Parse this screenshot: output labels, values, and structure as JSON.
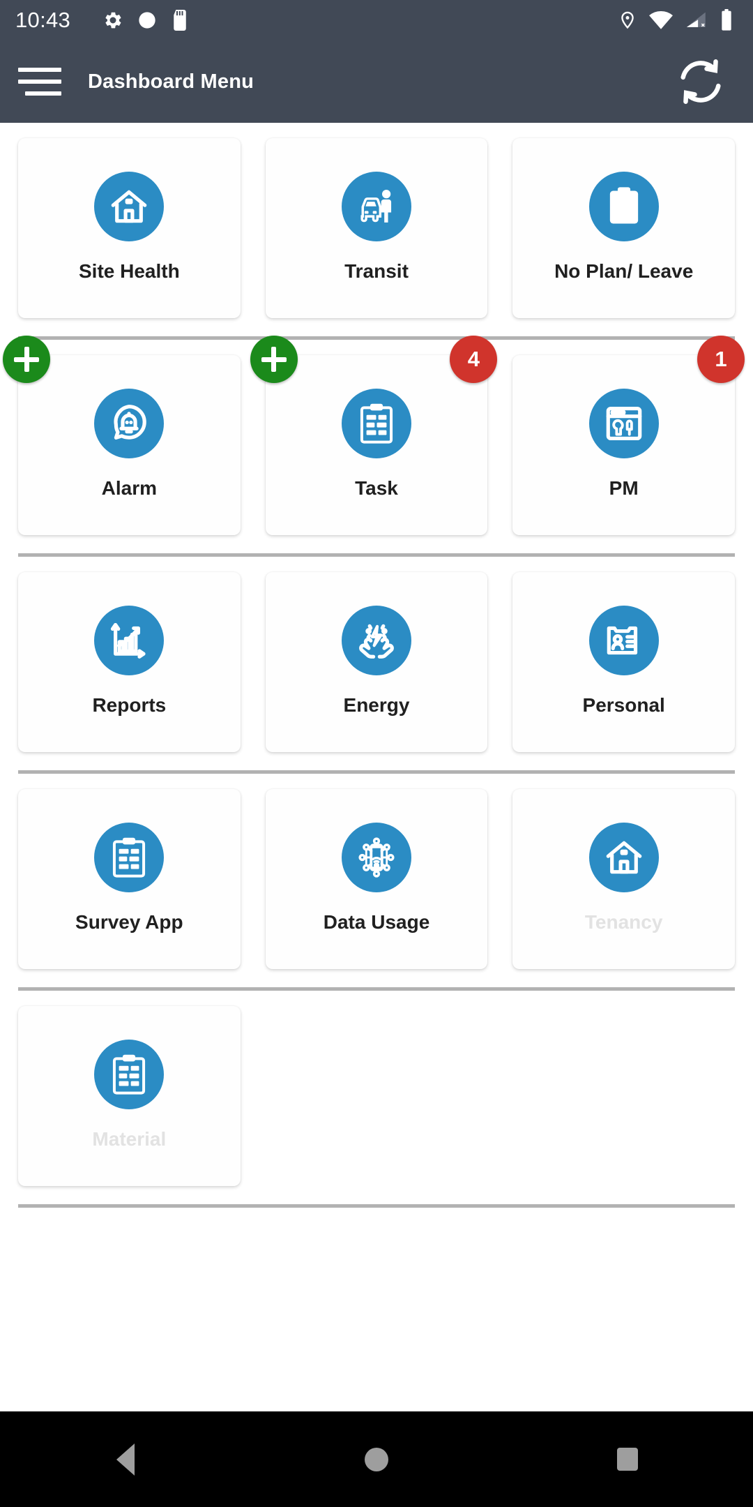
{
  "status_bar": {
    "time": "10:43",
    "left_icons": [
      "gear-icon",
      "circle-icon",
      "sd-card-icon"
    ],
    "right_icons": [
      "location-pin-icon",
      "wifi-icon",
      "cellular-no-signal-icon",
      "battery-icon"
    ],
    "background_color": "#414956"
  },
  "app_bar": {
    "menu_icon": "hamburger-menu-icon",
    "title": "Dashboard Menu",
    "action_icon": "sync-refresh-icon",
    "background_color": "#414956"
  },
  "theme": {
    "icon_circle_color": "#2b8cc4",
    "badge_color": "#d0342c",
    "add_button_color": "#1b8a1b",
    "divider_color": "#b2b2b2",
    "disabled_label_color": "#e2e2e2"
  },
  "rows": [
    {
      "cells": [
        {
          "label": "Site Health",
          "icon": "house-icon",
          "enabled": true,
          "badge": null,
          "add_button": false
        },
        {
          "label": "Transit",
          "icon": "car-person-icon",
          "enabled": true,
          "badge": null,
          "add_button": false
        },
        {
          "label": "No Plan/ Leave",
          "icon": "clipboard-blank-icon",
          "enabled": true,
          "badge": null,
          "add_button": false
        }
      ]
    },
    {
      "cells": [
        {
          "label": "Alarm",
          "icon": "bell-alert-icon",
          "enabled": true,
          "badge": null,
          "add_button": true
        },
        {
          "label": "Task",
          "icon": "clipboard-list-icon",
          "enabled": true,
          "badge": "4",
          "add_button": true
        },
        {
          "label": "PM",
          "icon": "maintenance-tools-icon",
          "enabled": true,
          "badge": "1",
          "add_button": false
        }
      ]
    },
    {
      "cells": [
        {
          "label": "Reports",
          "icon": "bar-chart-growth-icon",
          "enabled": true,
          "badge": null,
          "add_button": false
        },
        {
          "label": "Energy",
          "icon": "hands-lightning-icon",
          "enabled": true,
          "badge": null,
          "add_button": false
        },
        {
          "label": "Personal",
          "icon": "id-card-icon",
          "enabled": true,
          "badge": null,
          "add_button": false
        }
      ]
    },
    {
      "cells": [
        {
          "label": "Survey App",
          "icon": "clipboard-survey-icon",
          "enabled": true,
          "badge": null,
          "add_button": false
        },
        {
          "label": "Data Usage",
          "icon": "phone-network-icon",
          "enabled": true,
          "badge": null,
          "add_button": false
        },
        {
          "label": "Tenancy",
          "icon": "house-icon",
          "enabled": false,
          "badge": null,
          "add_button": false
        }
      ]
    },
    {
      "cells": [
        {
          "label": "Material",
          "icon": "clipboard-survey-icon",
          "enabled": false,
          "badge": null,
          "add_button": false
        }
      ]
    }
  ],
  "nav_bar": {
    "back_label": "back-button",
    "home_label": "home-button",
    "recents_label": "recents-button",
    "background_color": "#000000"
  }
}
